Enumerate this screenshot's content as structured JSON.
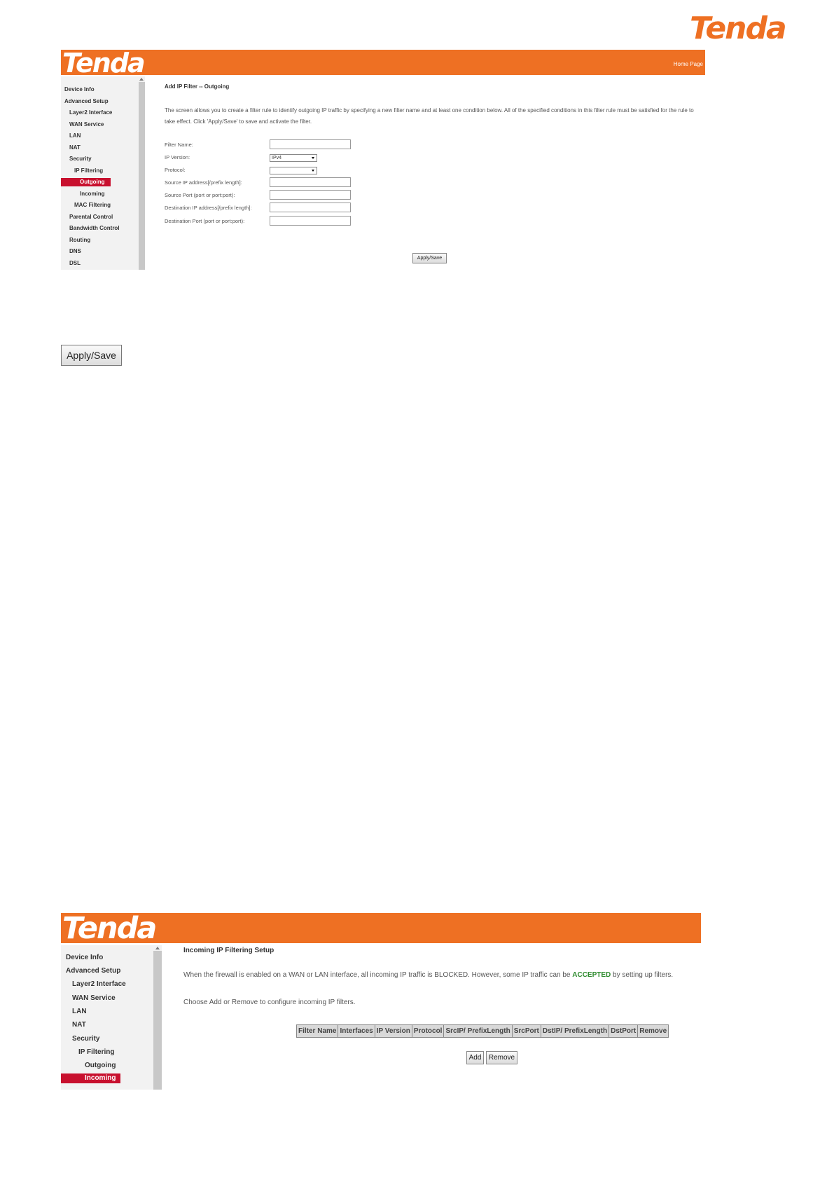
{
  "page_logo": "Tenda",
  "shot1": {
    "logo": "Tenda",
    "home_link": "Home Page",
    "sidebar": {
      "items": [
        "Device Info",
        "Advanced Setup",
        "Layer2 Interface",
        "WAN Service",
        "LAN",
        "NAT",
        "Security",
        "IP Filtering"
      ],
      "active": "Outgoing",
      "after": [
        "Incoming",
        "MAC Filtering",
        "Parental Control",
        "Bandwidth Control",
        "Routing",
        "DNS",
        "DSL"
      ]
    },
    "title": "Add IP Filter -- Outgoing",
    "description": "The screen allows you to create a filter rule to identify outgoing IP traffic by specifying a new filter name and at least one condition below. All of the specified conditions in this filter rule must be satisfied for the rule to take effect. Click 'Apply/Save' to save and activate the filter.",
    "form": {
      "filter_name_label": "Filter Name:",
      "ip_version_label": "IP Version:",
      "ip_version_value": "IPv4",
      "protocol_label": "Protocol:",
      "protocol_value": "",
      "src_ip_label": "Source IP address[/prefix length]:",
      "src_port_label": "Source Port (port or port:port):",
      "dst_ip_label": "Destination IP address[/prefix length]:",
      "dst_port_label": "Destination Port (port or port:port):"
    },
    "apply_button": "Apply/Save"
  },
  "standalone_button": "Apply/Save",
  "shot2": {
    "logo": "Tenda",
    "sidebar": {
      "items": [
        "Device Info",
        "Advanced Setup",
        "Layer2 Interface",
        "WAN Service",
        "LAN",
        "NAT",
        "Security",
        "IP Filtering",
        "Outgoing"
      ],
      "active": "Incoming"
    },
    "title": "Incoming IP Filtering Setup",
    "description_pre": "When the firewall is enabled on a WAN or LAN interface, all incoming IP traffic is BLOCKED. However, some IP traffic can be ",
    "description_accent": "ACCEPTED",
    "description_post": " by setting up filters.",
    "instruction": "Choose Add or Remove to configure incoming IP filters.",
    "table_headers": [
      "Filter Name",
      "Interfaces",
      "IP Version",
      "Protocol",
      "SrcIP/ PrefixLength",
      "SrcPort",
      "DstIP/ PrefixLength",
      "DstPort",
      "Remove"
    ],
    "add_button": "Add",
    "remove_button": "Remove"
  },
  "colors": {
    "brand": "#ee7023",
    "active": "#c8102e",
    "accent": "#2e8b2e"
  }
}
